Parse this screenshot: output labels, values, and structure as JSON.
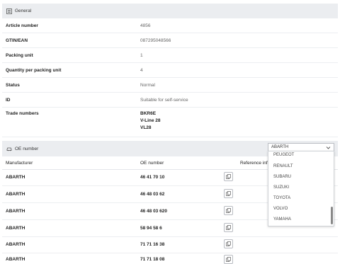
{
  "general": {
    "title": "General",
    "rows": [
      {
        "label": "Article number",
        "value": "4856"
      },
      {
        "label": "GTIN/EAN",
        "value": "087295048566"
      },
      {
        "label": "Packing unit",
        "value": "1"
      },
      {
        "label": "Quantity per packing unit",
        "value": "4"
      },
      {
        "label": "Status",
        "value": "Normal"
      },
      {
        "label": "ID",
        "value": "Suitable for self-service"
      },
      {
        "label": "Trade numbers",
        "value": ""
      }
    ],
    "trade_numbers": [
      "BKR6E",
      "V-Line 28",
      "VL28"
    ]
  },
  "oe": {
    "title": "OE number",
    "filter": {
      "selected": "ABARTH",
      "icon": "chevron-down-icon"
    },
    "dropdown_options": [
      "PEUGEOT",
      "RENAULT",
      "SUBARU",
      "SUZUKI",
      "TOYOTA",
      "VOLVO",
      "YAMAHA"
    ],
    "columns": {
      "manufacturer": "Manufacturer",
      "oe_number": "OE number",
      "reference": "Reference inf"
    },
    "rows": [
      {
        "manufacturer": "ABARTH",
        "oe_number": "46 41 70 10"
      },
      {
        "manufacturer": "ABARTH",
        "oe_number": "46 48 03 62"
      },
      {
        "manufacturer": "ABARTH",
        "oe_number": "46 48 03 620"
      },
      {
        "manufacturer": "ABARTH",
        "oe_number": "58 94 58 6"
      },
      {
        "manufacturer": "ABARTH",
        "oe_number": "71 71 16 38"
      },
      {
        "manufacturer": "ABARTH",
        "oe_number": "71 71 18 08"
      }
    ]
  }
}
